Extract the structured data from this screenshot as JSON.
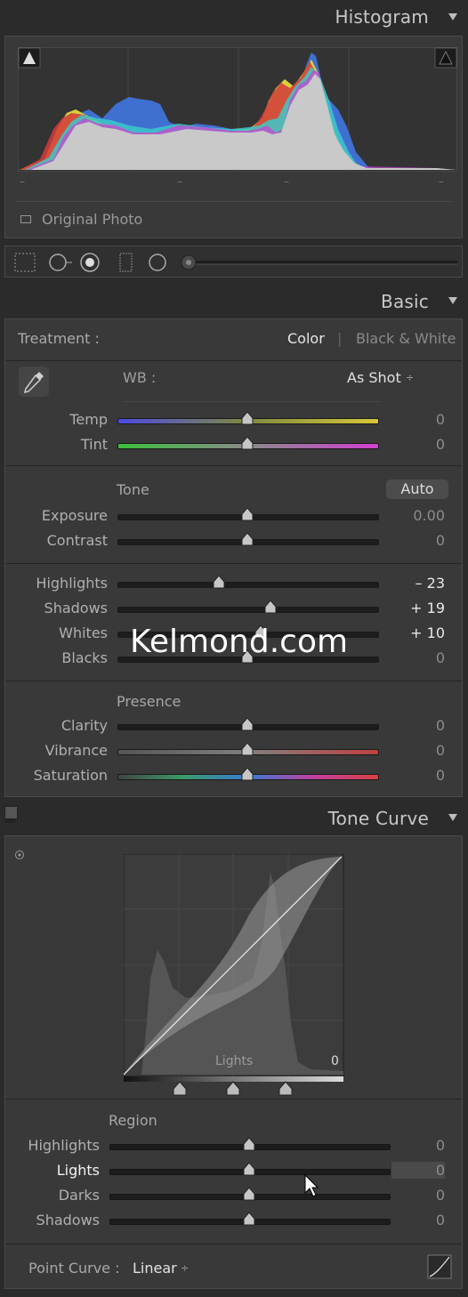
{
  "histogram": {
    "title": "Histogram",
    "original_photo_label": "Original Photo",
    "tick_marks": [
      "–",
      "–",
      "–",
      "–"
    ]
  },
  "basic": {
    "title": "Basic",
    "treatment_label": "Treatment :",
    "treatment_color": "Color",
    "treatment_divider": "|",
    "treatment_bw": "Black & White",
    "wb_label": "WB :",
    "wb_value": "As Shot",
    "wb_arrow": "÷",
    "temp": {
      "label": "Temp",
      "value": "0",
      "position": 0.5
    },
    "tint": {
      "label": "Tint",
      "value": "0",
      "position": 0.5
    },
    "tone_label": "Tone",
    "auto_label": "Auto",
    "exposure": {
      "label": "Exposure",
      "value": "0.00",
      "position": 0.5
    },
    "contrast": {
      "label": "Contrast",
      "value": "0",
      "position": 0.5
    },
    "highlights": {
      "label": "Highlights",
      "value": "– 23",
      "position": 0.39
    },
    "shadows": {
      "label": "Shadows",
      "value": "+ 19",
      "position": 0.59
    },
    "whites": {
      "label": "Whites",
      "value": "+ 10",
      "position": 0.55
    },
    "blacks": {
      "label": "Blacks",
      "value": "0",
      "position": 0.5
    },
    "presence_label": "Presence",
    "clarity": {
      "label": "Clarity",
      "value": "0",
      "position": 0.5
    },
    "vibrance": {
      "label": "Vibrance",
      "value": "0",
      "position": 0.5
    },
    "saturation": {
      "label": "Saturation",
      "value": "0",
      "position": 0.5
    }
  },
  "watermark": "Kelmond.com",
  "tone_curve": {
    "title": "Tone Curve",
    "graph_label": "Lights",
    "graph_value": "0",
    "region_label": "Region",
    "highlights": {
      "label": "Highlights",
      "value": "0",
      "position": 0.5
    },
    "lights": {
      "label": "Lights",
      "value": "0",
      "position": 0.5
    },
    "darks": {
      "label": "Darks",
      "value": "0",
      "position": 0.5
    },
    "shadows": {
      "label": "Shadows",
      "value": "0",
      "position": 0.5
    },
    "point_curve_label": "Point Curve :",
    "point_curve_value": "Linear",
    "point_curve_arrow": "÷"
  },
  "colors": {
    "panel_bg": "#393939",
    "page_bg": "#2b2b2b",
    "text": "#b0b0b0",
    "highlight_text": "#e8e8e8"
  }
}
